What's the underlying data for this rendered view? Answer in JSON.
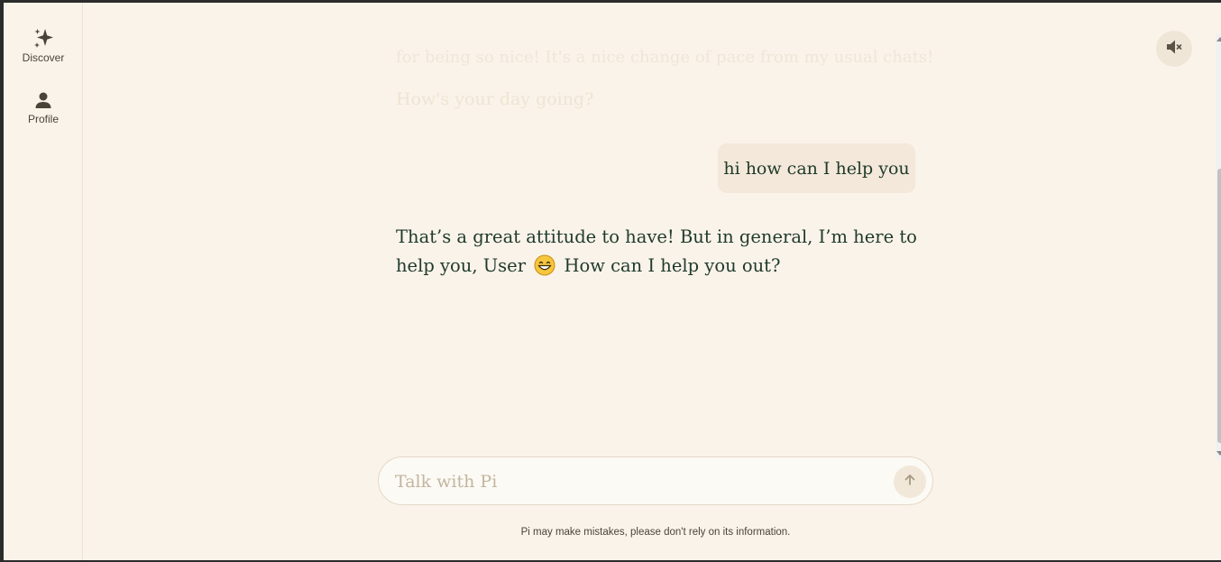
{
  "sidebar": {
    "items": [
      {
        "label": "Discover",
        "icon": "sparkle-icon"
      },
      {
        "label": "Profile",
        "icon": "person-icon"
      }
    ]
  },
  "header": {
    "mute_icon": "speaker-muted-icon"
  },
  "conversation": {
    "faded_line_1": "for being so nice! It's a nice change of pace from my usual chats!",
    "faded_line_2": "How's your day going?",
    "user_message": "hi how can I help you",
    "ai_message_part1": "That’s a great attitude to have! But in general, I’m here to help you, User",
    "ai_message_emoji": "grinning-face-icon",
    "ai_message_part2": "How can I help you out?"
  },
  "composer": {
    "placeholder": "Talk with Pi",
    "value": "",
    "send_icon": "arrow-up-icon"
  },
  "footer": {
    "disclaimer": "Pi may make mistakes, please don't rely on its information."
  },
  "colors": {
    "background": "#faf3ea",
    "text": "#1f3a2a",
    "bubble": "#f3e8d9",
    "muted": "#c2b5a0"
  }
}
